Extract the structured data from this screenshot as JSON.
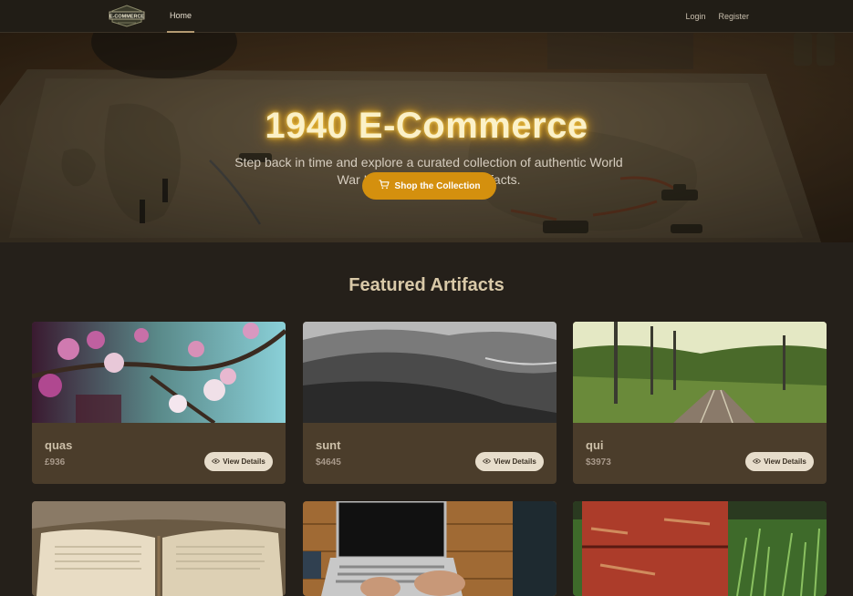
{
  "nav": {
    "brand_text": "E-COMMERCE",
    "home": "Home",
    "login": "Login",
    "register": "Register"
  },
  "hero": {
    "title": "1940 E-Commerce",
    "subtitle": "Step back in time and explore a curated collection of authentic World War II memorabilia and artifacts.",
    "cta": "Shop the Collection"
  },
  "featured": {
    "title": "Featured Artifacts",
    "view_label": "View Details",
    "products": [
      {
        "name": "quas",
        "price": "£936"
      },
      {
        "name": "sunt",
        "price": "$4645"
      },
      {
        "name": "qui",
        "price": "$3973"
      }
    ]
  },
  "icons": {
    "cart": "cart-icon",
    "eye": "eye-icon"
  }
}
